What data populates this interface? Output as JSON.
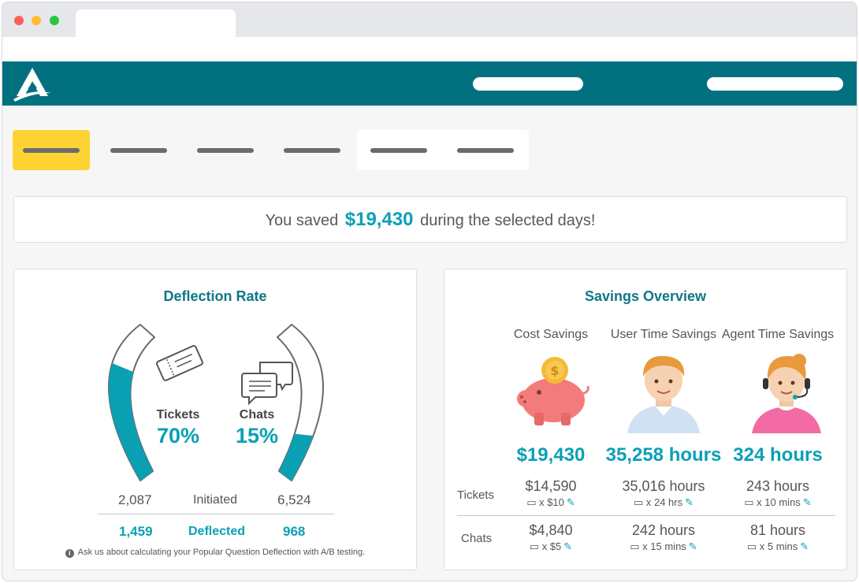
{
  "banner": {
    "prefix": "You saved",
    "amount": "$19,430",
    "suffix": "during the selected days!"
  },
  "deflection": {
    "title": "Deflection Rate",
    "tickets": {
      "label": "Tickets",
      "percent": "70%",
      "fill": 0.7
    },
    "chats": {
      "label": "Chats",
      "percent": "15%",
      "fill": 0.15
    },
    "initiated": {
      "label": "Initiated",
      "tickets": "2,087",
      "chats": "6,524"
    },
    "deflected": {
      "label": "Deflected",
      "tickets": "1,459",
      "chats": "968"
    },
    "note": "Ask us about calculating your Popular Question Deflection with A/B testing.",
    "info_icon": "info-icon"
  },
  "savings": {
    "title": "Savings Overview",
    "columns": [
      {
        "header": "Cost Savings",
        "total": "$19,430",
        "tickets_value": "$14,590",
        "tickets_mult": "x $10",
        "chats_value": "$4,840",
        "chats_mult": "x $5"
      },
      {
        "header": "User Time Savings",
        "total": "35,258 hours",
        "tickets_value": "35,016 hours",
        "tickets_mult": "x 24 hrs",
        "chats_value": "242 hours",
        "chats_mult": "x 15 mins"
      },
      {
        "header": "Agent Time Savings",
        "total": "324 hours",
        "tickets_value": "243 hours",
        "tickets_mult": "x 10 mins",
        "chats_value": "81 hours",
        "chats_mult": "x 5 mins"
      }
    ],
    "rows": {
      "tickets": "Tickets",
      "chats": "Chats"
    }
  },
  "colors": {
    "brand": "#01717f",
    "accent": "#0aa0b4",
    "tab_active": "#fdd334"
  }
}
